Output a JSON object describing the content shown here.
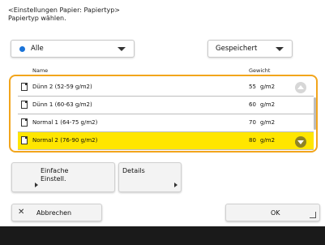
{
  "header": {
    "line1": "<Einstellungen Papier: Papiertyp>",
    "line2": "Papiertyp wählen."
  },
  "filter": {
    "selected": "Alle",
    "dot_color": "#1a73d8"
  },
  "sort": {
    "selected": "Gespeichert"
  },
  "columns": {
    "name": "Name",
    "weight": "Gewicht"
  },
  "rows": [
    {
      "name": "Dünn 2 (52-59 g/m2)",
      "weight": "55",
      "unit": "g/m2",
      "selected": false
    },
    {
      "name": "Dünn 1 (60-63 g/m2)",
      "weight": "60",
      "unit": "g/m2",
      "selected": false
    },
    {
      "name": "Normal 1 (64-75 g/m2)",
      "weight": "70",
      "unit": "g/m2",
      "selected": false
    },
    {
      "name": "Normal 2 (76-90 g/m2)",
      "weight": "80",
      "unit": "g/m2",
      "selected": true
    }
  ],
  "buttons": {
    "simple_line1": "Einfache",
    "simple_line2": "Einstell.",
    "details": "Details",
    "cancel": "Abbrechen",
    "ok": "OK"
  },
  "colors": {
    "accent_frame": "#f2a51c",
    "selected_row": "#ffe600"
  }
}
